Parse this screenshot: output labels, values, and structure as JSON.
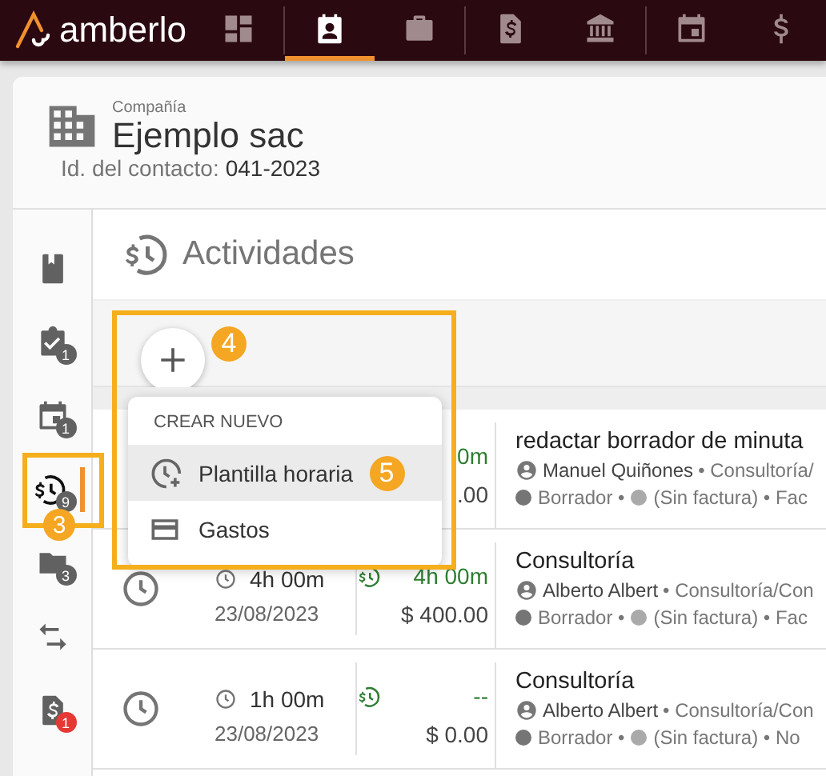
{
  "app": {
    "logo_text": "amberlo"
  },
  "top_nav": [
    {
      "selected": false
    },
    {
      "selected": true
    },
    {
      "selected": false
    },
    {
      "selected": false
    },
    {
      "selected": false
    },
    {
      "selected": false
    },
    {
      "selected": false
    }
  ],
  "contact": {
    "type": "Compañía",
    "name": "Ejemplo sac",
    "id_label": "Id. del contacto:",
    "id_value": "041-2023"
  },
  "sidebar": [
    {
      "selected": false
    },
    {
      "badge": "1",
      "selected": false
    },
    {
      "badge": "1",
      "selected": false
    },
    {
      "badge": "9",
      "selected": true
    },
    {
      "badge": "3",
      "selected": false
    },
    {
      "selected": false
    },
    {
      "badge": "1",
      "selected": false
    }
  ],
  "section": {
    "title": "Actividades"
  },
  "menu": {
    "header": "CREAR NUEVO",
    "items": [
      {
        "label": "Plantilla horaria",
        "selected": true
      },
      {
        "label": "Gastos",
        "selected": false
      }
    ]
  },
  "rows": [
    {
      "billed": "0m",
      "amount": ".00",
      "title": "redactar borrador de minuta",
      "person": "Manuel Quiñones",
      "matter": "• Consultoría/",
      "status": "Borrador •",
      "invoice": "(Sin factura) • Fac"
    },
    {
      "duration": "4h 00m",
      "date": "23/08/2023",
      "billed": "4h 00m",
      "amount": "$ 400.00",
      "title": "Consultoría",
      "person": "Alberto Albert",
      "matter": "• Consultoría/Con",
      "status": "Borrador •",
      "invoice": "(Sin factura) • Fac"
    },
    {
      "duration": "1h 00m",
      "date": "23/08/2023",
      "billed": "--",
      "amount": "$ 0.00",
      "title": "Consultoría",
      "person": "Alberto Albert",
      "matter": "• Consultoría/Con",
      "status": "Borrador •",
      "invoice": "(Sin factura) • No"
    }
  ],
  "callouts": [
    "3",
    "4",
    "5"
  ]
}
